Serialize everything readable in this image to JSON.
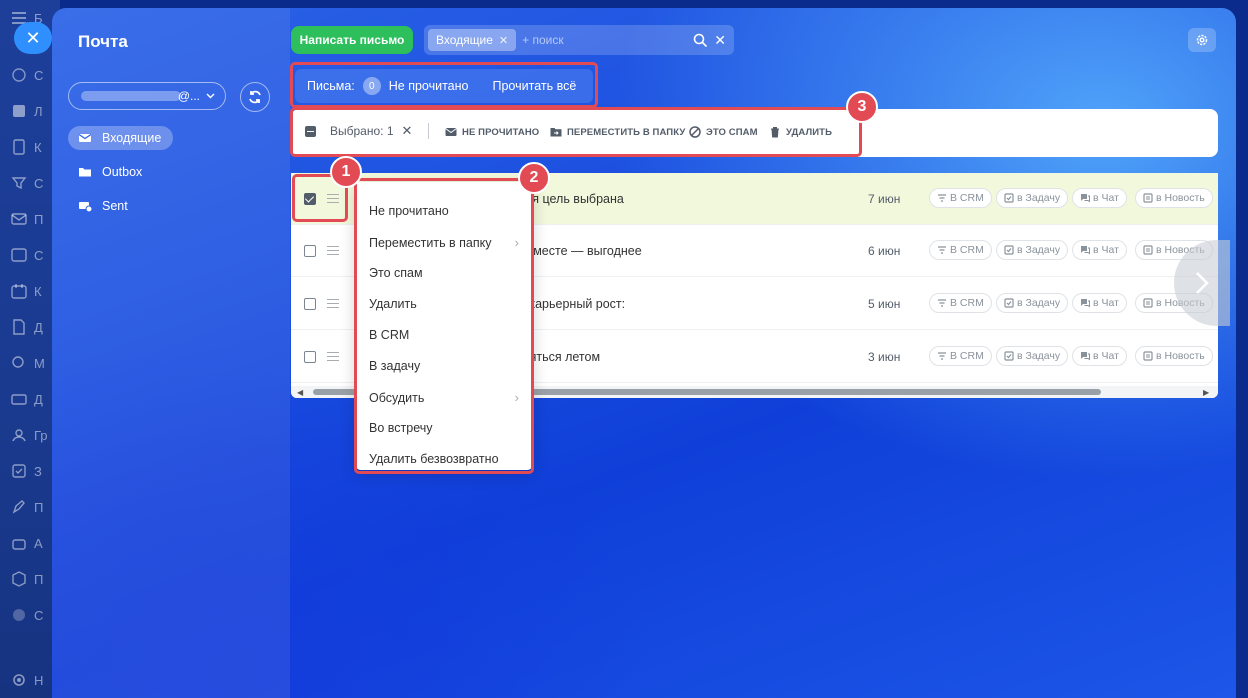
{
  "sidebar_title": "Почта",
  "account": {
    "domain_suffix": "@..."
  },
  "folders": [
    {
      "label": "Входящие",
      "icon": "envelope-icon",
      "active": true
    },
    {
      "label": "Outbox",
      "icon": "folder-icon",
      "active": false
    },
    {
      "label": "Sent",
      "icon": "sent-icon",
      "active": false
    }
  ],
  "toolbar": {
    "compose_label": "Написать письмо",
    "search_chip": "Входящие",
    "search_placeholder": "+ поиск"
  },
  "counter": {
    "label": "Письма:",
    "count": "0",
    "unread_label": "Не прочитано",
    "read_all_label": "Прочитать всё"
  },
  "action_bar": {
    "selected_label": "Выбрано: 1",
    "unread": "НЕ ПРОЧИТАНО",
    "move": "ПЕРЕМЕСТИТЬ В ПАПКУ",
    "spam": "ЭТО СПАМ",
    "delete": "УДАЛИТЬ"
  },
  "row_actions": {
    "crm": "В CRM",
    "task": "в Задачу",
    "chat": "в Чат",
    "news": "в Новость"
  },
  "rows": [
    {
      "subject": "рьерная цель выбрана",
      "date": "7 июн",
      "checked": true
    },
    {
      "subject": "иться вместе — выгоднее",
      "date": "6 июн",
      "checked": false
    },
    {
      "subject": "стрый карьерный рост:",
      "date": "5 июн",
      "checked": false
    },
    {
      "subject": "ем заняться летом",
      "date": "3 июн",
      "checked": false
    }
  ],
  "context_menu": [
    {
      "label": "Не прочитано",
      "submenu": false
    },
    {
      "label": "Переместить в папку",
      "submenu": true
    },
    {
      "label": "Это спам",
      "submenu": false
    },
    {
      "label": "Удалить",
      "submenu": false
    },
    {
      "label": "В CRM",
      "submenu": false
    },
    {
      "label": "В задачу",
      "submenu": false
    },
    {
      "label": "Обсудить",
      "submenu": true
    },
    {
      "label": "Во встречу",
      "submenu": false
    },
    {
      "label": "Удалить безвозвратно",
      "submenu": false
    }
  ],
  "badges": [
    "1",
    "2",
    "3"
  ],
  "left_rail": [
    {
      "letter": "Б"
    },
    {
      "letter": "С"
    },
    {
      "letter": "Л"
    },
    {
      "letter": "К"
    },
    {
      "letter": "С"
    },
    {
      "letter": "П"
    },
    {
      "letter": "С"
    },
    {
      "letter": "К"
    },
    {
      "letter": "Д"
    },
    {
      "letter": "М"
    },
    {
      "letter": "Д"
    },
    {
      "letter": "Гр"
    },
    {
      "letter": "З"
    },
    {
      "letter": "П"
    },
    {
      "letter": "А"
    },
    {
      "letter": "П"
    },
    {
      "letter": "С"
    },
    {
      "letter": "Н"
    }
  ],
  "colors": {
    "accent": "#2cbf5c",
    "annotation": "#e24a54",
    "selected_row": "#f2f8dc"
  }
}
